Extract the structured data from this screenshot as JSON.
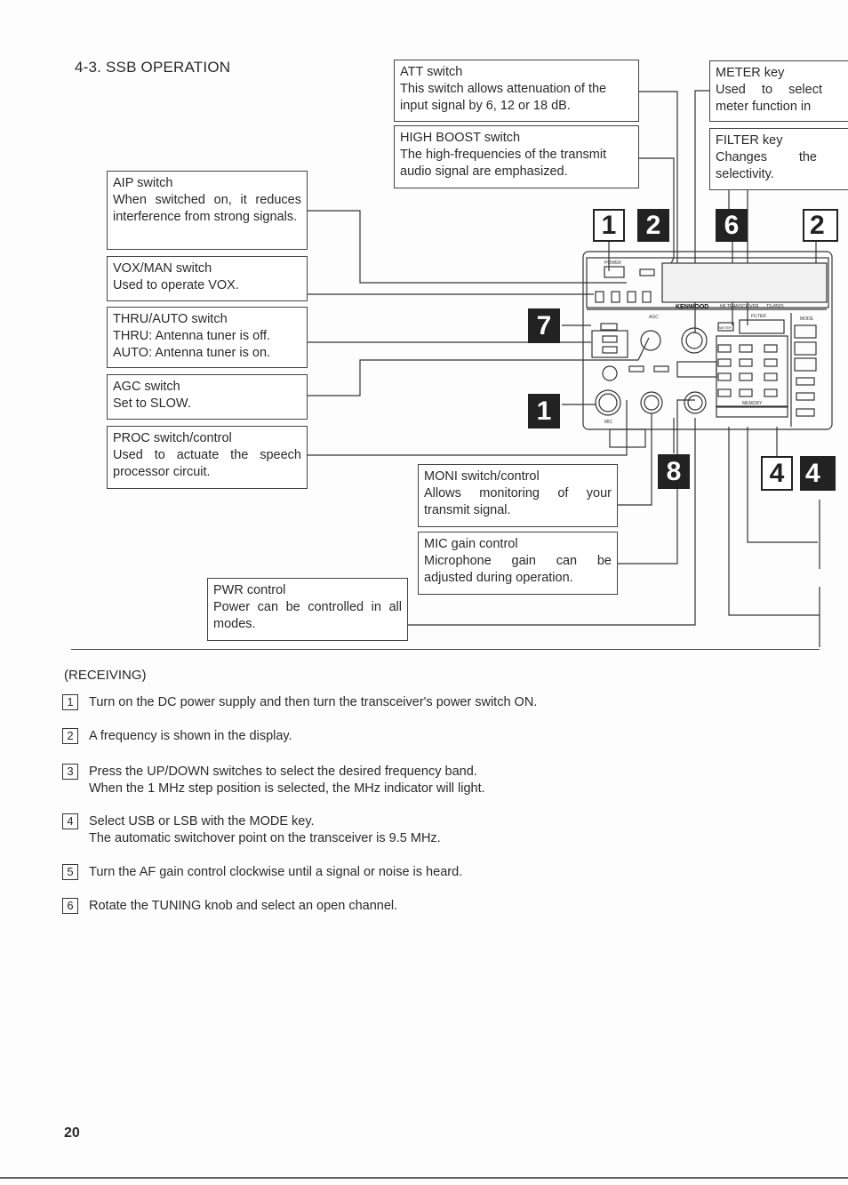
{
  "title": "4-3.  SSB OPERATION",
  "callouts": {
    "att": {
      "heading": "ATT switch",
      "body": "This switch allows attenuation of the input signal by 6, 12 or 18 dB."
    },
    "high_boost": {
      "heading": "HIGH BOOST switch",
      "body": "The high-frequencies of the transmit audio signal are emphasized."
    },
    "meter": {
      "heading": "METER key",
      "body": "Used to select meter function in"
    },
    "filter": {
      "heading": "FILTER key",
      "body": "Changes the selectivity."
    },
    "aip": {
      "heading": "AIP switch",
      "body": "When switched on, it reduces interference from strong signals."
    },
    "vox": {
      "heading": "VOX/MAN switch",
      "body": "Used to operate VOX."
    },
    "thru": {
      "heading": "THRU/AUTO switch",
      "line1": "THRU: Antenna tuner is off.",
      "line2": "AUTO: Antenna tuner is on."
    },
    "agc": {
      "heading": "AGC switch",
      "body": "Set to SLOW."
    },
    "proc": {
      "heading": "PROC switch/control",
      "body": "Used to actuate the speech processor circuit."
    },
    "moni": {
      "heading": "MONI switch/control",
      "body": "Allows monitoring of your transmit signal."
    },
    "mic": {
      "heading": "MIC gain control",
      "body": "Microphone gain can be adjusted during operation."
    },
    "pwr": {
      "heading": "PWR control",
      "body": "Power can be controlled in all modes."
    }
  },
  "step_markers": [
    "1",
    "2",
    "6",
    "2",
    "7",
    "1",
    "8",
    "4",
    "4"
  ],
  "radio_panel": {
    "brand": "KENWOOD",
    "type": "HF TRANSCEIVER",
    "model": "TS-850S",
    "power": "POWER",
    "filter": "FILTER",
    "mode": "MODE",
    "meter": "METER",
    "mic": "MIC",
    "agc": "AGC",
    "memory": "MEMORY"
  },
  "receiving": {
    "heading": "(RECEIVING)",
    "steps": [
      {
        "n": "1",
        "lines": [
          "Turn on the DC power supply and then turn the transceiver's power switch ON."
        ]
      },
      {
        "n": "2",
        "lines": [
          "A frequency is shown in the display."
        ]
      },
      {
        "n": "3",
        "lines": [
          "Press the UP/DOWN switches to select the desired frequency band.",
          "When the 1 MHz step position is selected, the MHz indicator will light."
        ]
      },
      {
        "n": "4",
        "lines": [
          "Select USB or LSB with the MODE key.",
          "The automatic switchover point on the transceiver is 9.5 MHz."
        ]
      },
      {
        "n": "5",
        "lines": [
          "Turn the AF gain control clockwise until a signal or noise is heard."
        ]
      },
      {
        "n": "6",
        "lines": [
          "Rotate the TUNING knob and select an open channel."
        ]
      }
    ]
  },
  "page_number": "20"
}
